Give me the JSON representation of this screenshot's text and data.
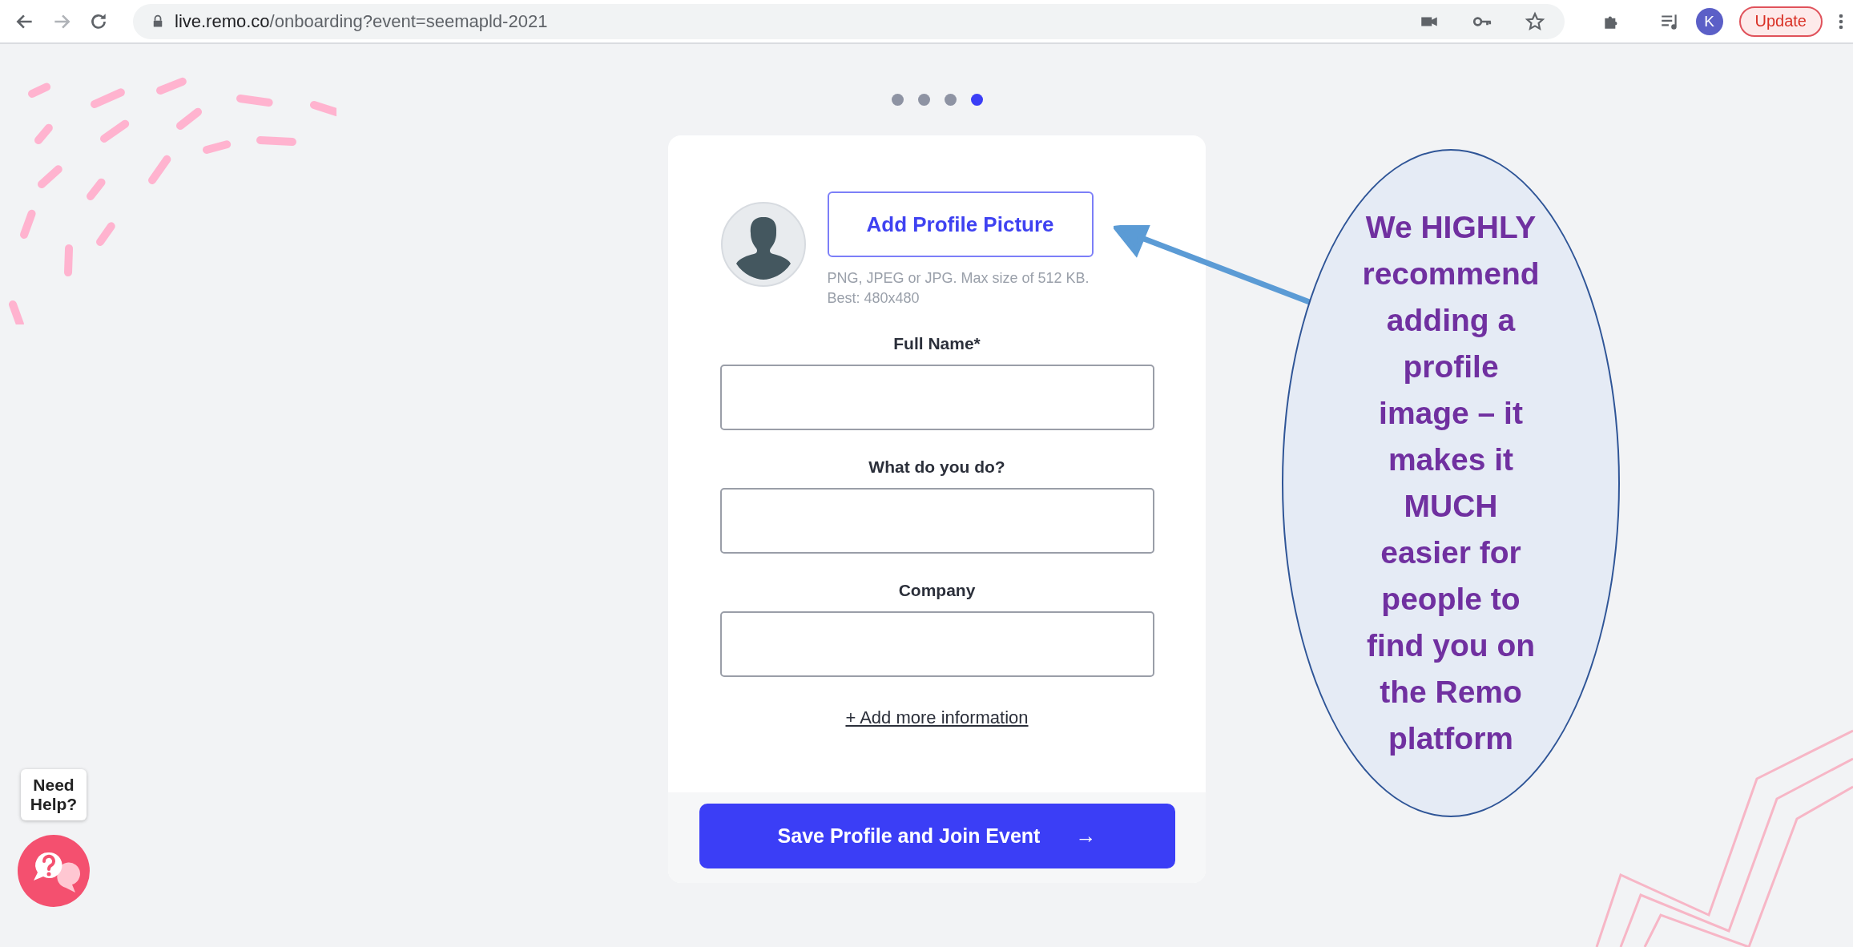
{
  "browser": {
    "url_host": "live.remo.co",
    "url_path": "/onboarding?event=seemapld-2021",
    "profile_letter": "K",
    "update_label": "Update"
  },
  "steps": [
    {
      "selected": false
    },
    {
      "selected": false
    },
    {
      "selected": false
    },
    {
      "selected": true
    }
  ],
  "profile": {
    "button": "Add Profile Picture",
    "hint_lines": [
      "PNG, JPEG or JPG. Max size of 512 KB.",
      "Best: 480x480"
    ]
  },
  "fields": [
    {
      "label": "Full Name*"
    },
    {
      "label": "What do you do?"
    },
    {
      "label": "Company"
    }
  ],
  "more_link": "+ Add more information",
  "submit": {
    "label": "Save Profile and Join Event",
    "arrow": "→"
  },
  "help": {
    "label": "Need Help?"
  },
  "callout": {
    "text": "We HIGHLY recommend adding a profile image – it makes it MUCH easier for people to find you on the Remo platform"
  }
}
